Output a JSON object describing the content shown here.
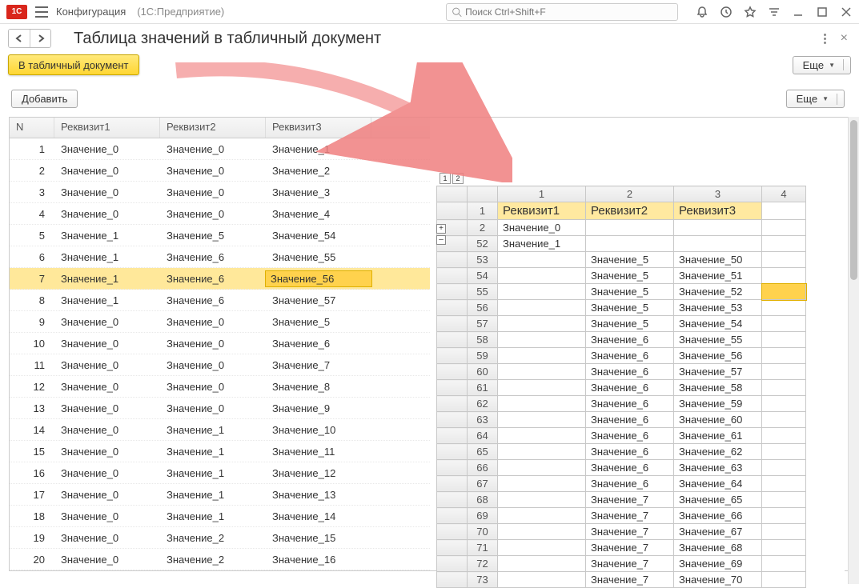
{
  "titlebar": {
    "logo_text": "1C",
    "config": "Конфигурация",
    "app": "(1С:Предприятие)",
    "search_placeholder": "Поиск Ctrl+Shift+F"
  },
  "page": {
    "title": "Таблица значений в табличный документ",
    "btn_to_doc": "В табличный документ",
    "btn_add": "Добавить",
    "btn_more": "Еще"
  },
  "left_table": {
    "headers": {
      "n": "N",
      "r1": "Реквизит1",
      "r2": "Реквизит2",
      "r3": "Реквизит3"
    },
    "selected": 7,
    "rows": [
      {
        "n": 1,
        "r1": "Значение_0",
        "r2": "Значение_0",
        "r3": "Значение_1"
      },
      {
        "n": 2,
        "r1": "Значение_0",
        "r2": "Значение_0",
        "r3": "Значение_2"
      },
      {
        "n": 3,
        "r1": "Значение_0",
        "r2": "Значение_0",
        "r3": "Значение_3"
      },
      {
        "n": 4,
        "r1": "Значение_0",
        "r2": "Значение_0",
        "r3": "Значение_4"
      },
      {
        "n": 5,
        "r1": "Значение_1",
        "r2": "Значение_5",
        "r3": "Значение_54"
      },
      {
        "n": 6,
        "r1": "Значение_1",
        "r2": "Значение_6",
        "r3": "Значение_55"
      },
      {
        "n": 7,
        "r1": "Значение_1",
        "r2": "Значение_6",
        "r3": "Значение_56"
      },
      {
        "n": 8,
        "r1": "Значение_1",
        "r2": "Значение_6",
        "r3": "Значение_57"
      },
      {
        "n": 9,
        "r1": "Значение_0",
        "r2": "Значение_0",
        "r3": "Значение_5"
      },
      {
        "n": 10,
        "r1": "Значение_0",
        "r2": "Значение_0",
        "r3": "Значение_6"
      },
      {
        "n": 11,
        "r1": "Значение_0",
        "r2": "Значение_0",
        "r3": "Значение_7"
      },
      {
        "n": 12,
        "r1": "Значение_0",
        "r2": "Значение_0",
        "r3": "Значение_8"
      },
      {
        "n": 13,
        "r1": "Значение_0",
        "r2": "Значение_0",
        "r3": "Значение_9"
      },
      {
        "n": 14,
        "r1": "Значение_0",
        "r2": "Значение_1",
        "r3": "Значение_10"
      },
      {
        "n": 15,
        "r1": "Значение_0",
        "r2": "Значение_1",
        "r3": "Значение_11"
      },
      {
        "n": 16,
        "r1": "Значение_0",
        "r2": "Значение_1",
        "r3": "Значение_12"
      },
      {
        "n": 17,
        "r1": "Значение_0",
        "r2": "Значение_1",
        "r3": "Значение_13"
      },
      {
        "n": 18,
        "r1": "Значение_0",
        "r2": "Значение_1",
        "r3": "Значение_14"
      },
      {
        "n": 19,
        "r1": "Значение_0",
        "r2": "Значение_2",
        "r3": "Значение_15"
      },
      {
        "n": 20,
        "r1": "Значение_0",
        "r2": "Значение_2",
        "r3": "Значение_16"
      }
    ]
  },
  "right_sheet": {
    "col_heads": [
      "1",
      "2",
      "3",
      "4"
    ],
    "header_row_num": "1",
    "headers": [
      "Реквизит1",
      "Реквизит2",
      "Реквизит3"
    ],
    "outline_levels": [
      "1",
      "2"
    ],
    "outline_btns": [
      "+",
      "–"
    ],
    "rows": [
      {
        "rn": "2",
        "c1": "Значение_0",
        "c2": "",
        "c3": ""
      },
      {
        "rn": "52",
        "c1": "Значение_1",
        "c2": "",
        "c3": ""
      },
      {
        "rn": "53",
        "c1": "",
        "c2": "Значение_5",
        "c3": "Значение_50"
      },
      {
        "rn": "54",
        "c1": "",
        "c2": "Значение_5",
        "c3": "Значение_51"
      },
      {
        "rn": "55",
        "c1": "",
        "c2": "Значение_5",
        "c3": "Значение_52",
        "sel": true
      },
      {
        "rn": "56",
        "c1": "",
        "c2": "Значение_5",
        "c3": "Значение_53"
      },
      {
        "rn": "57",
        "c1": "",
        "c2": "Значение_5",
        "c3": "Значение_54"
      },
      {
        "rn": "58",
        "c1": "",
        "c2": "Значение_6",
        "c3": "Значение_55"
      },
      {
        "rn": "59",
        "c1": "",
        "c2": "Значение_6",
        "c3": "Значение_56"
      },
      {
        "rn": "60",
        "c1": "",
        "c2": "Значение_6",
        "c3": "Значение_57"
      },
      {
        "rn": "61",
        "c1": "",
        "c2": "Значение_6",
        "c3": "Значение_58"
      },
      {
        "rn": "62",
        "c1": "",
        "c2": "Значение_6",
        "c3": "Значение_59"
      },
      {
        "rn": "63",
        "c1": "",
        "c2": "Значение_6",
        "c3": "Значение_60"
      },
      {
        "rn": "64",
        "c1": "",
        "c2": "Значение_6",
        "c3": "Значение_61"
      },
      {
        "rn": "65",
        "c1": "",
        "c2": "Значение_6",
        "c3": "Значение_62"
      },
      {
        "rn": "66",
        "c1": "",
        "c2": "Значение_6",
        "c3": "Значение_63"
      },
      {
        "rn": "67",
        "c1": "",
        "c2": "Значение_6",
        "c3": "Значение_64"
      },
      {
        "rn": "68",
        "c1": "",
        "c2": "Значение_7",
        "c3": "Значение_65"
      },
      {
        "rn": "69",
        "c1": "",
        "c2": "Значение_7",
        "c3": "Значение_66"
      },
      {
        "rn": "70",
        "c1": "",
        "c2": "Значение_7",
        "c3": "Значение_67"
      },
      {
        "rn": "71",
        "c1": "",
        "c2": "Значение_7",
        "c3": "Значение_68"
      },
      {
        "rn": "72",
        "c1": "",
        "c2": "Значение_7",
        "c3": "Значение_69"
      },
      {
        "rn": "73",
        "c1": "",
        "c2": "Значение_7",
        "c3": "Значение_70"
      }
    ]
  }
}
